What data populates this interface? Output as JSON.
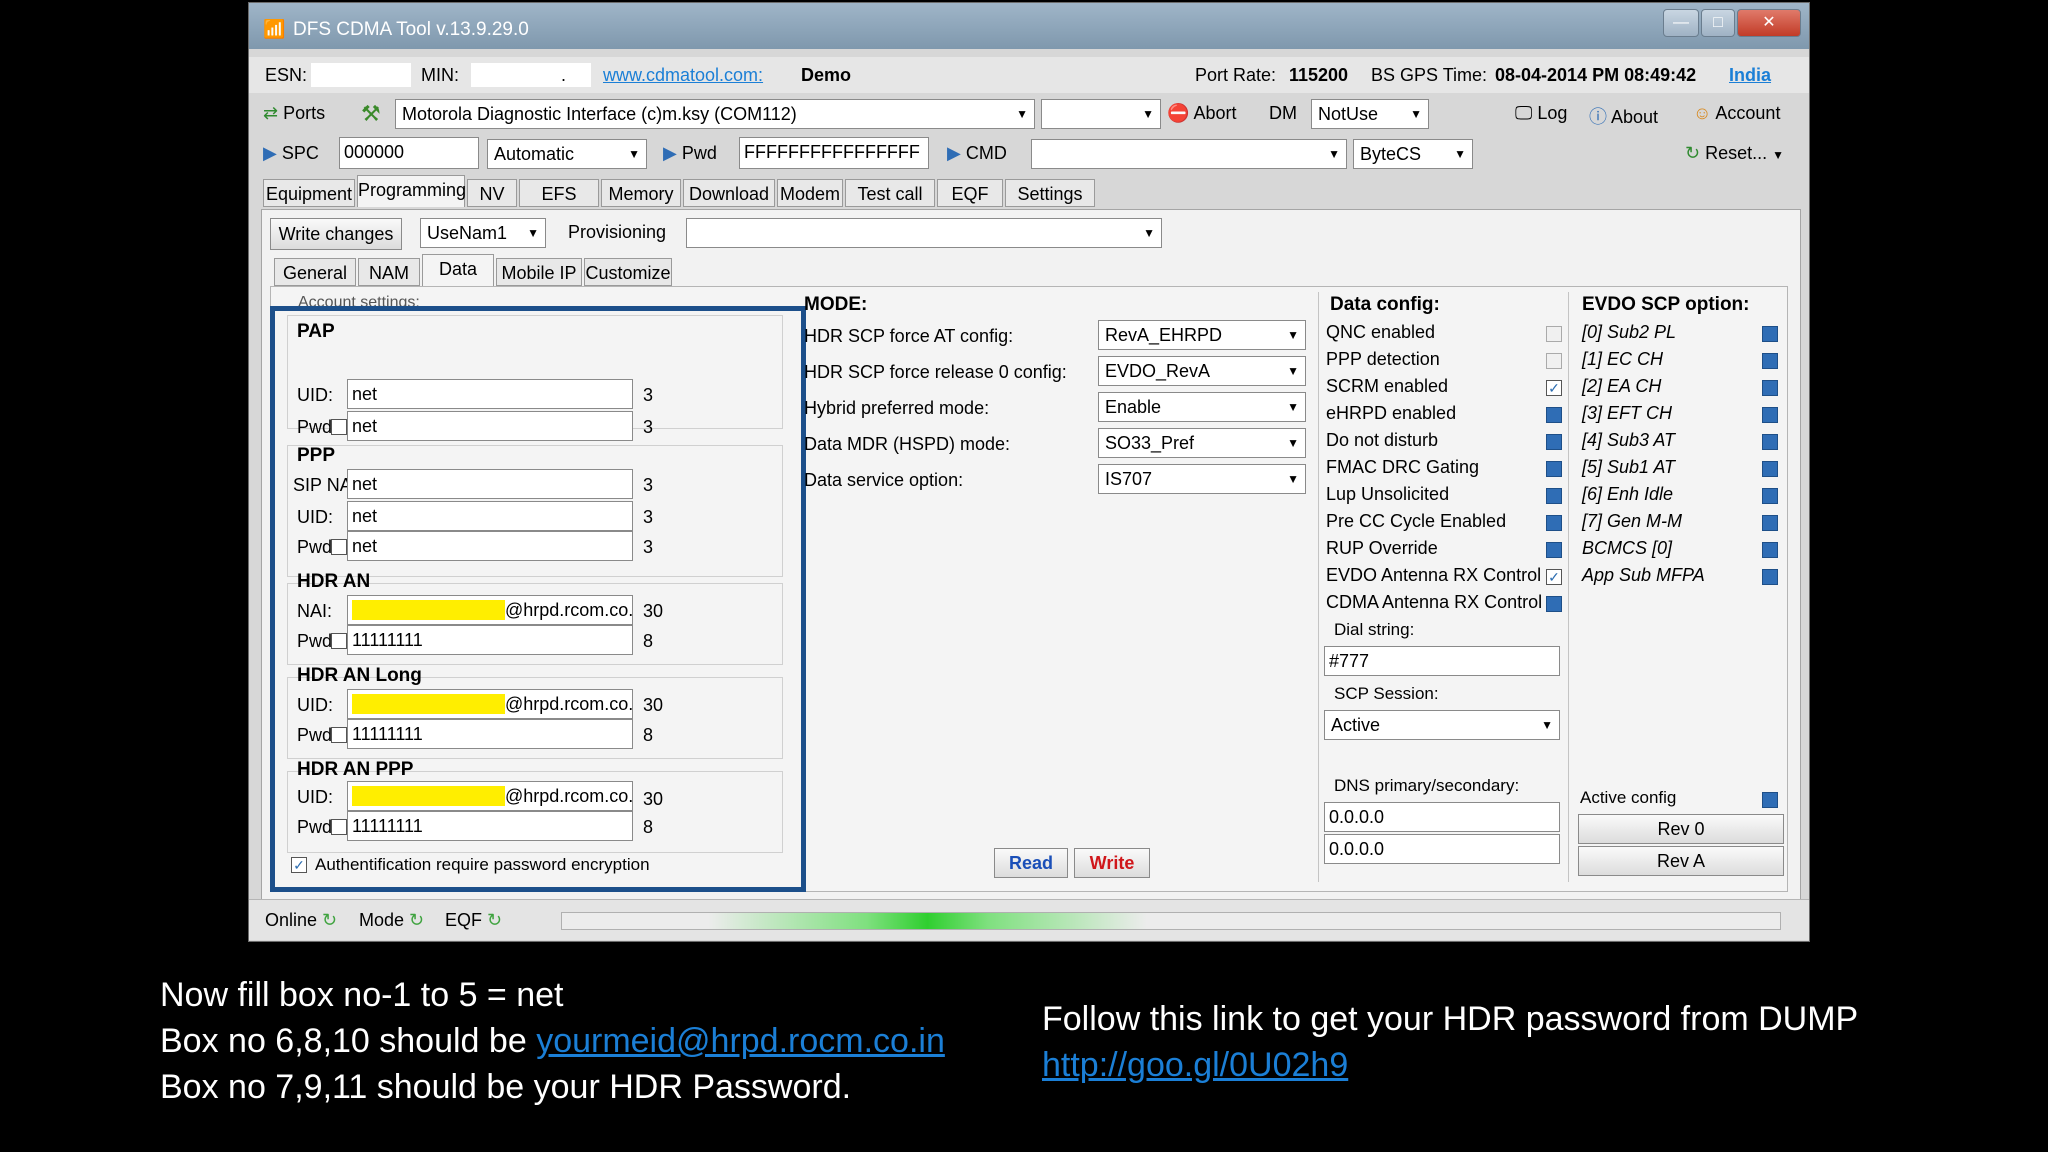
{
  "window": {
    "title": "DFS CDMA Tool v.13.9.29.0"
  },
  "infobar": {
    "esn_label": "ESN:",
    "min_label": "MIN:",
    "min_value": ".",
    "site_link": "www.cdmatool.com:",
    "demo": "Demo",
    "port_rate_label": "Port Rate:",
    "port_rate": "115200",
    "gps_label": "BS GPS Time:",
    "gps_time": "08-04-2014 PM 08:49:42",
    "region": "India"
  },
  "toolbar1": {
    "ports": "Ports",
    "interface": "Motorola Diagnostic Interface (c)m.ksy (COM112)",
    "abort": "Abort",
    "dm": "DM",
    "dm_value": "NotUse",
    "log": "Log",
    "about": "About",
    "account": "Account"
  },
  "toolbar2": {
    "spc": "SPC",
    "spc_value": "000000",
    "mode": "Automatic",
    "pwd": "Pwd",
    "pwd_value": "FFFFFFFFFFFFFFFF",
    "cmd": "CMD",
    "cmd_mode": "ByteCS",
    "reset": "Reset..."
  },
  "tabs": [
    "Equipment",
    "Programming",
    "NV",
    "EFS",
    "Memory",
    "Download",
    "Modem",
    "Test call",
    "EQF",
    "Settings"
  ],
  "prog": {
    "write_changes": "Write changes",
    "nam": "UseNam1",
    "provisioning": "Provisioning"
  },
  "subtabs": [
    "General",
    "NAM",
    "Data",
    "Mobile IP",
    "Customize"
  ],
  "account": {
    "legend": "Account settings:",
    "pap": {
      "title": "PAP",
      "uid_label": "UID:",
      "uid": "net",
      "uid_len": "3",
      "pwd_label": "Pwd",
      "pwd": "net",
      "pwd_len": "3"
    },
    "ppp": {
      "title": "PPP",
      "sip_label": "SIP NAI",
      "sip": "net",
      "sip_len": "3",
      "uid_label": "UID:",
      "uid": "net",
      "uid_len": "3",
      "pwd_label": "Pwd",
      "pwd": "net",
      "pwd_len": "3"
    },
    "hdr_an": {
      "title": "HDR AN",
      "nai_label": "NAI:",
      "nai_masked": "xxxxxxxxxxxxxxxxx",
      "nai_domain": "@hrpd.rcom.co.in",
      "nai_len": "30",
      "pwd_label": "Pwd",
      "pwd": "11111111",
      "pwd_len": "8"
    },
    "hdr_an_long": {
      "title": "HDR AN Long",
      "uid_label": "UID:",
      "uid_masked": "xxxxxxxxxxxxxxxxx",
      "uid_domain": "@hrpd.rcom.co.in",
      "uid_len": "30",
      "pwd_label": "Pwd",
      "pwd": "11111111",
      "pwd_len": "8"
    },
    "hdr_an_ppp": {
      "title": "HDR AN PPP",
      "uid_label": "UID:",
      "uid_masked": "xxxxxxxxxxxxxxxxx",
      "uid_domain": "@hrpd.rcom.co.in",
      "uid_len": "30",
      "pwd_label": "Pwd",
      "pwd": "11111111",
      "pwd_len": "8"
    },
    "auth": "Authentification require password encryption"
  },
  "mode": {
    "title": "MODE:",
    "rows": [
      {
        "label": "HDR SCP force AT config:",
        "value": "RevA_EHRPD"
      },
      {
        "label": "HDR SCP force release 0 config:",
        "value": "EVDO_RevA"
      },
      {
        "label": "Hybrid preferred mode:",
        "value": "Enable"
      },
      {
        "label": "Data MDR (HSPD) mode:",
        "value": "SO33_Pref"
      },
      {
        "label": "Data service option:",
        "value": "IS707"
      }
    ],
    "read": "Read",
    "write": "Write"
  },
  "dataconfig": {
    "title": "Data config:",
    "items": [
      {
        "label": "QNC enabled",
        "state": "off"
      },
      {
        "label": "PPP detection",
        "state": "off"
      },
      {
        "label": "SCRM enabled",
        "state": "checked"
      },
      {
        "label": "eHRPD enabled",
        "state": "blue"
      },
      {
        "label": "Do not disturb",
        "state": "blue"
      },
      {
        "label": "FMAC DRC Gating",
        "state": "blue"
      },
      {
        "label": "Lup Unsolicited",
        "state": "blue"
      },
      {
        "label": "Pre CC Cycle Enabled",
        "state": "blue"
      },
      {
        "label": "RUP Override",
        "state": "blue"
      },
      {
        "label": "EVDO Antenna RX Control",
        "state": "checked"
      },
      {
        "label": "CDMA Antenna RX Control",
        "state": "blue"
      }
    ],
    "dial_label": "Dial string:",
    "dial": "#777",
    "scp_label": "SCP Session:",
    "scp": "Active",
    "dns_label": "DNS primary/secondary:",
    "dns1": "0.0.0.0",
    "dns2": "0.0.0.0"
  },
  "evdo": {
    "title": "EVDO SCP option:",
    "items": [
      "[0] Sub2 PL",
      "[1] EC CH",
      "[2] EA CH",
      "[3] EFT CH",
      "[4] Sub3 AT",
      "[5] Sub1 AT",
      "[6] Enh Idle",
      "[7] Gen M-M",
      "BCMCS [0]",
      "App Sub MFPA"
    ],
    "active_config": "Active config",
    "rev0": "Rev 0",
    "reva": "Rev A"
  },
  "status": {
    "online": "Online",
    "mode": "Mode",
    "eqf": "EQF"
  },
  "caption": {
    "line1": "Now fill box no-1 to 5 = net",
    "line2_prefix": "Box no 6,8,10 should be ",
    "line2_link": "yourmeid@hrpd.rocm.co.in",
    "line3": "Box no 7,9,11 should be your HDR Password.",
    "right1": "Follow this link to get your HDR password from DUMP",
    "right2": "http://goo.gl/0U02h9"
  },
  "colors": {
    "highlight_box": "#1c4f8a",
    "read_text": "#1a4fb8",
    "write_text": "#d0161a",
    "link": "#1b7fd6",
    "mask": "#ffee00"
  }
}
